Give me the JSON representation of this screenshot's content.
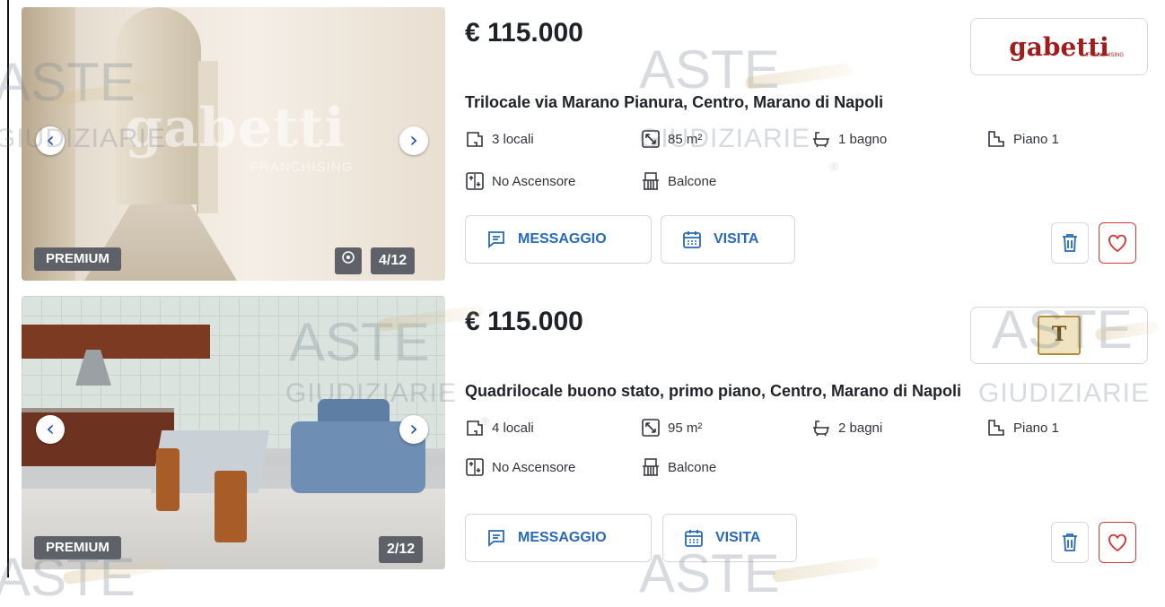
{
  "listings": [
    {
      "price": "€ 115.000",
      "title": "Trilocale via Marano Pianura, Centro, Marano di Napoli",
      "features": {
        "rooms": "3 locali",
        "area": "85 m²",
        "bathrooms": "1 bagno",
        "floor": "Piano 1",
        "elevator": "No Ascensore",
        "balcony": "Balcone"
      },
      "badge": "PREMIUM",
      "photo_counter": "4/12",
      "photo_watermark": "gabetti",
      "photo_watermark_sub": "FRANCHISING",
      "agency_name": "gabetti",
      "agency_sub": "FRANCHISING",
      "message_label": "MESSAGGIO",
      "visit_label": "VISITA",
      "prev_label": "‹",
      "next_label": "›"
    },
    {
      "price": "€ 115.000",
      "title": "Quadrilocale buono stato, primo piano, Centro, Marano di Napoli",
      "features": {
        "rooms": "4 locali",
        "area": "95 m²",
        "bathrooms": "2 bagni",
        "floor": "Piano 1",
        "elevator": "No Ascensore",
        "balcony": "Balcone"
      },
      "badge": "PREMIUM",
      "photo_counter": "2/12",
      "agency_seal": "T",
      "message_label": "MESSAGGIO",
      "visit_label": "VISITA",
      "prev_label": "‹",
      "next_label": "›"
    }
  ],
  "site_watermark": {
    "line1": "ASTE",
    "line2": "GIUDIZIARIE",
    "registered": "®"
  },
  "colors": {
    "accent": "#2869b8",
    "favorite": "#d23a3a",
    "badge_bg": "#5e6167"
  }
}
